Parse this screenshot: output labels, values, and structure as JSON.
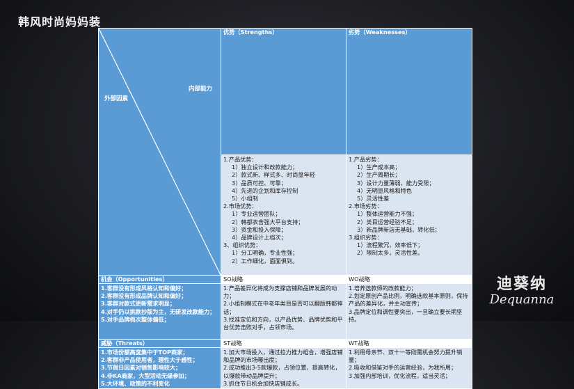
{
  "brand_title": "韩风时尚妈妈装",
  "corner": {
    "internal": "内部能力",
    "external": "外部因素"
  },
  "headers": {
    "strengths": "优势（Strengths）",
    "weaknesses": "劣势（Weaknesses）",
    "opportunities": "机会（Opportunities）",
    "threats": "威胁（Threats）",
    "so": "SO战略",
    "wo": "WO战略",
    "st": "ST战略",
    "wt": "WT战略"
  },
  "strengths": [
    "1.产品优势：",
    "1）独立设计和改款能力；",
    "2）款式新、样式多、时尚显年轻",
    "3）品质可控、可靠；",
    "4）先进的企划和库存控制",
    "5）小组制",
    "2.市场优势：",
    "1）专业运营团队；",
    "2）韩都衣舍强大平台支持；",
    "3）资金和投入保障；",
    "4）品牌设计上档次；",
    "3、组织优势：",
    "1）分工明确，专业性强；",
    "2）工作细化，面面俱到。"
  ],
  "weaknesses": [
    "1.产品劣势：",
    "1）生产成本高；",
    "2）生产周期长；",
    "3）设计力量薄弱，能力受限；",
    "4）无明显风格和特色",
    "5）灵活性差",
    "2.市场劣势：",
    "1）整体运营能力不强；",
    "2）类目运营经验不足；",
    "3）新品牌新店无基础，转化低；",
    "3.组织劣势：",
    "1）流程繁冗，效率低下；",
    "2）限制太多，灵活性差。"
  ],
  "opportunities": [
    "1.客群没有形成风格认知和偏好；",
    "2.客群没有形成品牌认知和偏好；",
    "3.客群对款式更新需求明显；",
    "4.对手仍以挑款抄版为主，无研发改款能力；",
    "5.对手品牌档次整体偏低；"
  ],
  "so": [
    "1.产品差异化将成为支撑店铺和品牌发展的动力；",
    "2.小组制模式在中老年类目是否可以翻版韩都神话；",
    "3.找准定位和方向，以产品优势、品牌优势和平台优势击败对手，占领市场。"
  ],
  "wo": [
    "1.培养选款师的改款能力；",
    "2.划定原创产品比例，明确选款基本原则，保持产品的差异化，并主动宣传；",
    "3.品牌定位和调性要突出，一旦确立要长期坚持。"
  ],
  "threats": [
    "1.市场份额高度集中于TOP商家；",
    "2.客群非产品使用者，理性大于感性；",
    "3.节假日因素对销售影响较大；",
    "4.非KA商家，大型活动无缘参加；",
    "5.大环境、政策的不利变化"
  ],
  "st": [
    "1.加大市场投入，通过拉力推力组合，增强店铺和品牌的市场曝出度；",
    "2.成功推出3-5款爆款，占领位置，提高转化，以爆款带动品牌提升；",
    "3.抓住节日机会加快店铺成长。"
  ],
  "wt": [
    "1.利用母亲节、双十一等刚需机会努力提升销量；",
    "2.吸收和借鉴对手的运营经验，为我所用；",
    "3.加强内部培训，优化流程，适当灵活；"
  ],
  "logo": {
    "cn": "迪葵纳",
    "en": "Dequanna"
  }
}
